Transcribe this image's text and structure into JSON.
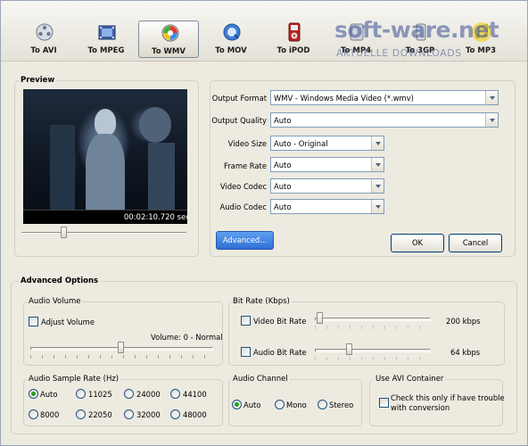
{
  "toolbar": {
    "buttons": [
      {
        "label": "To AVI",
        "icon": "film-reel-icon"
      },
      {
        "label": "To MPEG",
        "icon": "film-strip-icon"
      },
      {
        "label": "To WMV",
        "icon": "windows-media-icon",
        "active": true
      },
      {
        "label": "To MOV",
        "icon": "quicktime-icon"
      },
      {
        "label": "To iPOD",
        "icon": "ipod-icon"
      },
      {
        "label": "To MP4",
        "icon": "mp4-icon"
      },
      {
        "label": "To 3GP",
        "icon": "phone-icon"
      },
      {
        "label": "To MP3",
        "icon": "music-note-icon"
      }
    ]
  },
  "watermark": {
    "line1": "soft-ware.net",
    "line2": "AKTUELLE DOWNLOADS"
  },
  "preview": {
    "title": "Preview",
    "time": "00:02:10.720 sec"
  },
  "settings": {
    "output_format": {
      "label": "Output Format",
      "value": "WMV - Windows Media Video (*.wmv)"
    },
    "output_quality": {
      "label": "Output Quality",
      "value": "Auto"
    },
    "video_size": {
      "label": "Video Size",
      "value": "Auto - Original"
    },
    "frame_rate": {
      "label": "Frame Rate",
      "value": "Auto"
    },
    "video_codec": {
      "label": "Video Codec",
      "value": "Auto"
    },
    "audio_codec": {
      "label": "Audio Codec",
      "value": "Auto"
    },
    "advanced_button": "Advanced...",
    "ok_button": "OK",
    "cancel_button": "Cancel"
  },
  "advanced": {
    "title": "Advanced Options",
    "audio_volume": {
      "title": "Audio Volume",
      "checkbox": "Adjust Volume",
      "status": "Volume: 0 - Normal"
    },
    "bitrate": {
      "title": "Bit Rate (Kbps)",
      "video": {
        "label": "Video Bit Rate",
        "value": "200 kbps"
      },
      "audio": {
        "label": "Audio Bit Rate",
        "value": "64 kbps"
      }
    },
    "sample_rate": {
      "title": "Audio Sample Rate (Hz)",
      "options": [
        "Auto",
        "11025",
        "24000",
        "44100",
        "8000",
        "22050",
        "32000",
        "48000"
      ],
      "selected": "Auto"
    },
    "channel": {
      "title": "Audio Channel",
      "options": [
        "Auto",
        "Mono",
        "Stereo"
      ],
      "selected": "Auto"
    },
    "avi": {
      "title": "Use AVI Container",
      "checkbox_line1": "Check this only if have trouble",
      "checkbox_line2": "with conversion"
    }
  }
}
